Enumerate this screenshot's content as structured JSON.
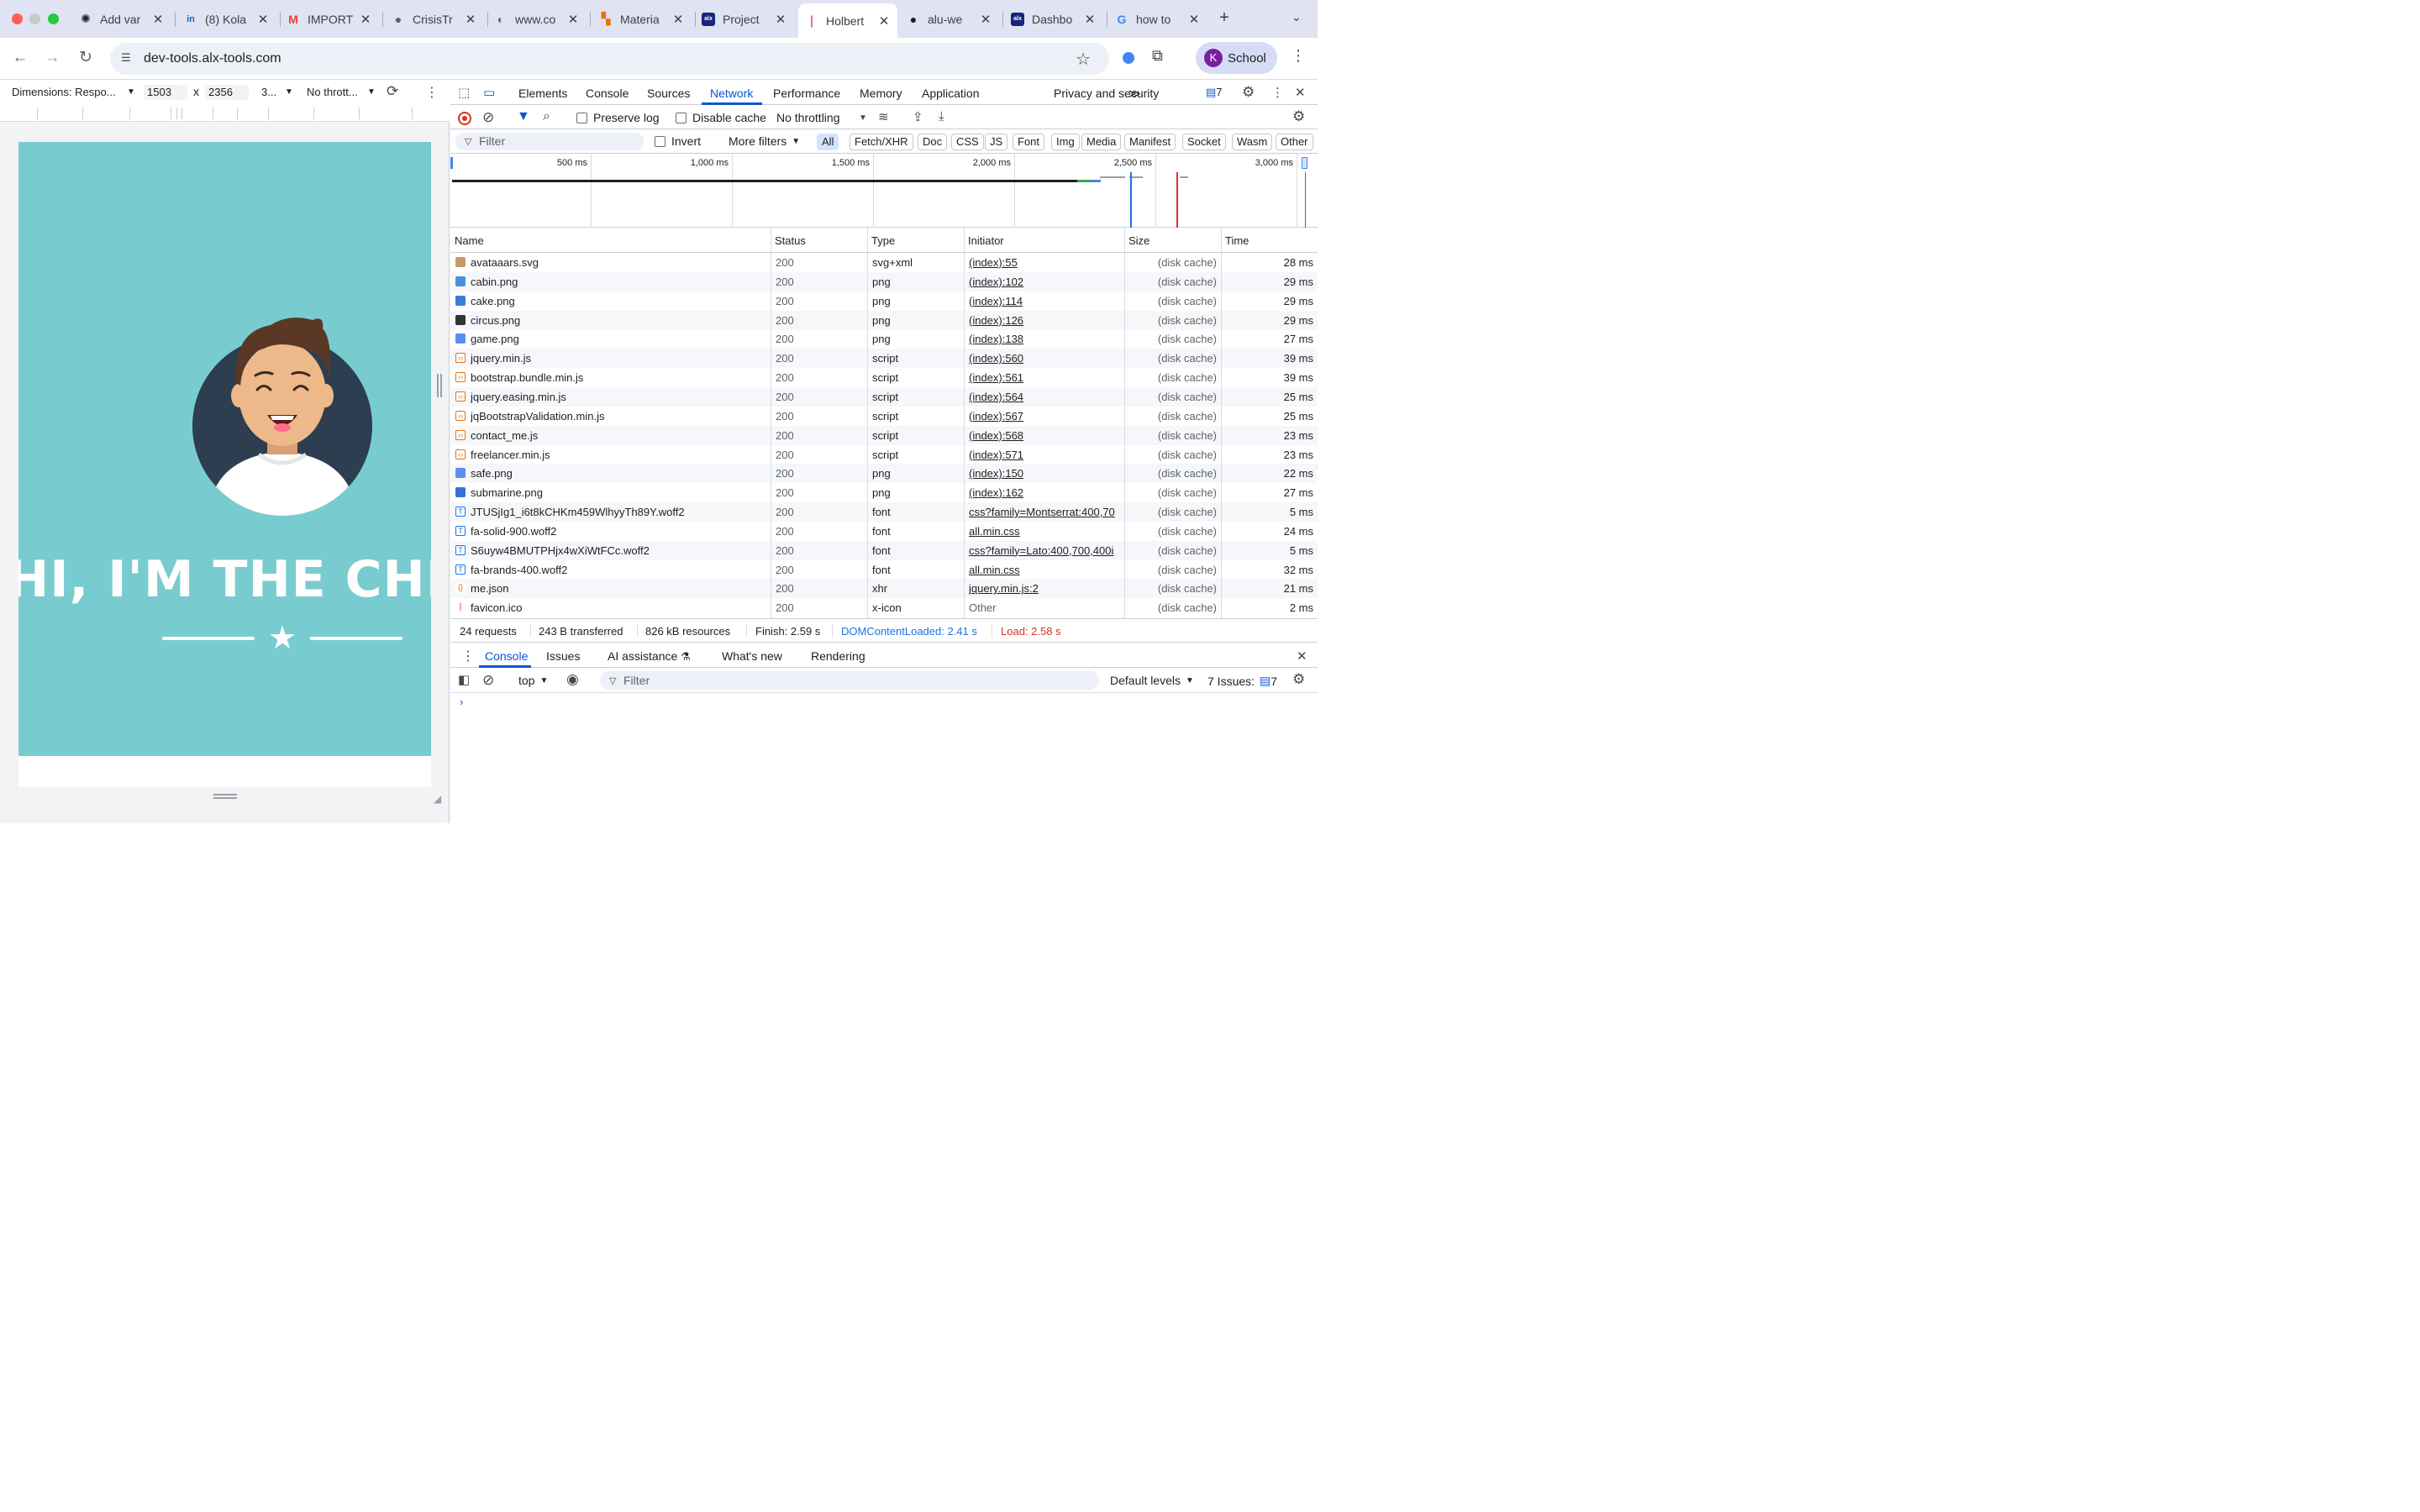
{
  "tabs": [
    {
      "title": "Add var",
      "icon": "chatgpt-icon",
      "color": "#1f1f1f",
      "glyph": "✺"
    },
    {
      "title": "(8) Kola",
      "icon": "linkedin-icon",
      "color": "#0a66c2",
      "glyph": "in"
    },
    {
      "title": "IMPORT",
      "icon": "gmail-icon",
      "color": "#ea4335",
      "glyph": "M"
    },
    {
      "title": "CrisisTr",
      "icon": "globe-icon",
      "color": "#5f6368",
      "glyph": "●"
    },
    {
      "title": "www.co",
      "icon": "generic-g-icon",
      "color": "#5f6368",
      "glyph": "◐"
    },
    {
      "title": "Materia",
      "icon": "material-icon",
      "color": "#e8710a",
      "glyph": "▚"
    },
    {
      "title": "Project",
      "icon": "alx-icon",
      "color": "#1a237e",
      "glyph": "alx"
    },
    {
      "title": "Holbert",
      "icon": "holberton-icon",
      "color": "#e0003c",
      "glyph": "❘"
    },
    {
      "title": "alu-we",
      "icon": "github-icon",
      "color": "#1f1f1f",
      "glyph": "●"
    },
    {
      "title": "Dashbo",
      "icon": "alx-icon",
      "color": "#1a237e",
      "glyph": "alx"
    },
    {
      "title": "how to",
      "icon": "google-icon",
      "color": "#4285f4",
      "glyph": "G"
    }
  ],
  "url": "dev-tools.alx-tools.com",
  "profile": {
    "initial": "K",
    "name": "School"
  },
  "device_bar": {
    "dimensions": "Dimensions: Respo...",
    "width": "1503",
    "times": "x",
    "height": "2356",
    "zoom": "3...",
    "throttle": "No thrott..."
  },
  "page": {
    "hero_title": "HI, I'M THE CHECKER",
    "star": "★"
  },
  "devtools": {
    "panels": [
      "Elements",
      "Console",
      "Sources",
      "Network",
      "Performance",
      "Memory",
      "Application",
      "Privacy and security"
    ],
    "active_panel": "Network",
    "more": "≫",
    "issues_count": "7",
    "network_toolbar": {
      "preserve_log": "Preserve log",
      "disable_cache": "Disable cache",
      "throttling": "No throttling"
    },
    "filter": {
      "placeholder": "Filter",
      "invert": "Invert",
      "more_filters": "More filters",
      "types": [
        "All",
        "Fetch/XHR",
        "Doc",
        "CSS",
        "JS",
        "Font",
        "Img",
        "Media",
        "Manifest",
        "Socket",
        "Wasm",
        "Other"
      ],
      "active_type": "All"
    },
    "overview_ticks": [
      "500 ms",
      "1,000 ms",
      "1,500 ms",
      "2,000 ms",
      "2,500 ms",
      "3,000 ms"
    ],
    "columns": [
      "Name",
      "Status",
      "Type",
      "Initiator",
      "Size",
      "Time"
    ],
    "requests": [
      {
        "name": "avataaars.svg",
        "status": "200",
        "type": "svg+xml",
        "initiator": "(index):55",
        "size": "(disk cache)",
        "time": "28 ms",
        "kind": "img"
      },
      {
        "name": "cabin.png",
        "status": "200",
        "type": "png",
        "initiator": "(index):102",
        "size": "(disk cache)",
        "time": "29 ms",
        "kind": "img"
      },
      {
        "name": "cake.png",
        "status": "200",
        "type": "png",
        "initiator": "(index):114",
        "size": "(disk cache)",
        "time": "29 ms",
        "kind": "img"
      },
      {
        "name": "circus.png",
        "status": "200",
        "type": "png",
        "initiator": "(index):126",
        "size": "(disk cache)",
        "time": "29 ms",
        "kind": "img"
      },
      {
        "name": "game.png",
        "status": "200",
        "type": "png",
        "initiator": "(index):138",
        "size": "(disk cache)",
        "time": "27 ms",
        "kind": "img"
      },
      {
        "name": "jquery.min.js",
        "status": "200",
        "type": "script",
        "initiator": "(index):560",
        "size": "(disk cache)",
        "time": "39 ms",
        "kind": "script"
      },
      {
        "name": "bootstrap.bundle.min.js",
        "status": "200",
        "type": "script",
        "initiator": "(index):561",
        "size": "(disk cache)",
        "time": "39 ms",
        "kind": "script"
      },
      {
        "name": "jquery.easing.min.js",
        "status": "200",
        "type": "script",
        "initiator": "(index):564",
        "size": "(disk cache)",
        "time": "25 ms",
        "kind": "script"
      },
      {
        "name": "jqBootstrapValidation.min.js",
        "status": "200",
        "type": "script",
        "initiator": "(index):567",
        "size": "(disk cache)",
        "time": "25 ms",
        "kind": "script"
      },
      {
        "name": "contact_me.js",
        "status": "200",
        "type": "script",
        "initiator": "(index):568",
        "size": "(disk cache)",
        "time": "23 ms",
        "kind": "script"
      },
      {
        "name": "freelancer.min.js",
        "status": "200",
        "type": "script",
        "initiator": "(index):571",
        "size": "(disk cache)",
        "time": "23 ms",
        "kind": "script"
      },
      {
        "name": "safe.png",
        "status": "200",
        "type": "png",
        "initiator": "(index):150",
        "size": "(disk cache)",
        "time": "22 ms",
        "kind": "img"
      },
      {
        "name": "submarine.png",
        "status": "200",
        "type": "png",
        "initiator": "(index):162",
        "size": "(disk cache)",
        "time": "27 ms",
        "kind": "img"
      },
      {
        "name": "JTUSjIg1_i6t8kCHKm459WlhyyTh89Y.woff2",
        "status": "200",
        "type": "font",
        "initiator": "css?family=Montserrat:400,70",
        "size": "(disk cache)",
        "time": "5 ms",
        "kind": "font"
      },
      {
        "name": "fa-solid-900.woff2",
        "status": "200",
        "type": "font",
        "initiator": "all.min.css",
        "size": "(disk cache)",
        "time": "24 ms",
        "kind": "font"
      },
      {
        "name": "S6uyw4BMUTPHjx4wXiWtFCc.woff2",
        "status": "200",
        "type": "font",
        "initiator": "css?family=Lato:400,700,400i",
        "size": "(disk cache)",
        "time": "5 ms",
        "kind": "font"
      },
      {
        "name": "fa-brands-400.woff2",
        "status": "200",
        "type": "font",
        "initiator": "all.min.css",
        "size": "(disk cache)",
        "time": "32 ms",
        "kind": "font"
      },
      {
        "name": "me.json",
        "status": "200",
        "type": "xhr",
        "initiator": "jquery.min.js:2",
        "size": "(disk cache)",
        "time": "21 ms",
        "kind": "xhr"
      },
      {
        "name": "favicon.ico",
        "status": "200",
        "type": "x-icon",
        "initiator": "Other",
        "size": "(disk cache)",
        "time": "2 ms",
        "kind": "favicon"
      }
    ],
    "summary": {
      "requests": "24 requests",
      "transferred": "243 B transferred",
      "resources": "826 kB resources",
      "finish": "Finish: 2.59 s",
      "dcl": "DOMContentLoaded: 2.41 s",
      "load": "Load: 2.58 s"
    },
    "drawer_tabs": [
      "Console",
      "Issues",
      "AI assistance",
      "What's new",
      "Rendering"
    ],
    "console": {
      "context": "top",
      "filter_placeholder": "Filter",
      "levels": "Default levels",
      "issues_label": "7 Issues:",
      "issues_count": "7",
      "prompt": "›"
    }
  },
  "colors": {
    "accent": "#0b57d0",
    "dcl": "#1a73e8",
    "load": "#d93025",
    "hero_bg": "#78cccf",
    "avatar_circle": "#2c3e50"
  }
}
